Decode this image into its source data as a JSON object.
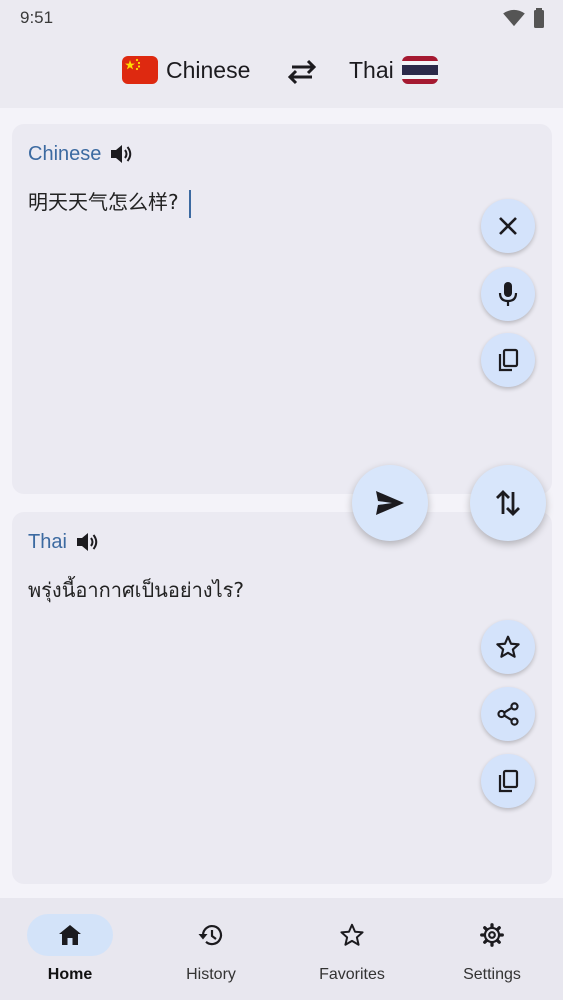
{
  "status": {
    "time": "9:51"
  },
  "header": {
    "source_lang": "Chinese",
    "target_lang": "Thai"
  },
  "source_card": {
    "language": "Chinese",
    "text": "明天天气怎么样?"
  },
  "target_card": {
    "language": "Thai",
    "text": "พรุ่งนี้อากาศเป็นอย่างไร?"
  },
  "nav": {
    "items": [
      {
        "label": "Home",
        "icon": "home-icon",
        "active": true
      },
      {
        "label": "History",
        "icon": "history-icon",
        "active": false
      },
      {
        "label": "Favorites",
        "icon": "star-icon",
        "active": false
      },
      {
        "label": "Settings",
        "icon": "gear-icon",
        "active": false
      }
    ]
  },
  "colors": {
    "accent": "#3c6aa1",
    "button_bg": "#d4e3fb",
    "card_bg": "#ebeaf2",
    "page_bg": "#f4f3f9"
  }
}
